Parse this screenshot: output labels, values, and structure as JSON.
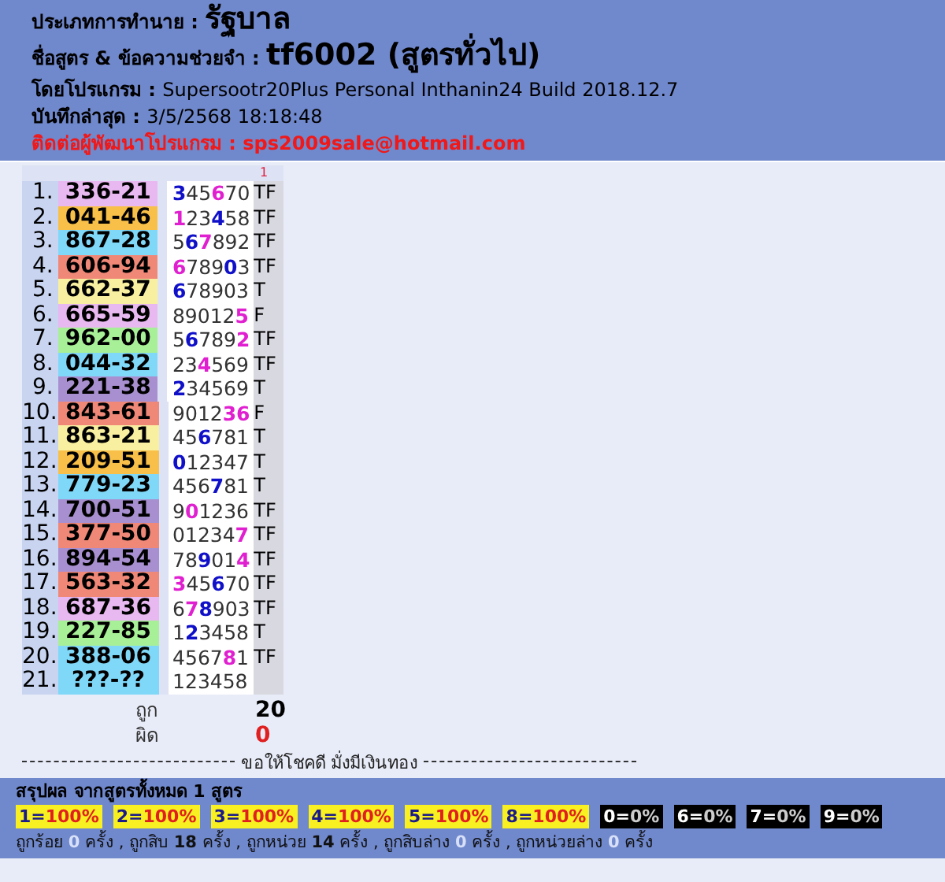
{
  "header": [
    {
      "kind": "title",
      "label": "ประเภทการทำนาย : ",
      "value": "รัฐบาล"
    },
    {
      "kind": "title",
      "label": "ชื่อสูตร & ข้อความช่วยจำ : ",
      "value": "tf6002 (สูตรทั่วไป)"
    },
    {
      "kind": "plain",
      "label": "โดยโปรแกรม : ",
      "value": "Supersootr20Plus Personal Inthanin24 Build 2018.12.7"
    },
    {
      "kind": "plain",
      "label": "บันทึกล่าสุด : ",
      "value": "3/5/2568 18:18:48"
    },
    {
      "kind": "alert",
      "label": "ติดต่อผู้พัฒนาโปรแกรม : ",
      "value": "sps2009sale@hotmail.com"
    }
  ],
  "column_marker": "1",
  "rows": [
    {
      "index": "1.",
      "number": "336-21",
      "color": "#e8b8f0",
      "digits": [
        {
          "d": "3",
          "color": "#1010c8"
        },
        {
          "d": "4"
        },
        {
          "d": "5"
        },
        {
          "d": "6",
          "color": "#e020d0"
        },
        {
          "d": "7"
        },
        {
          "d": "0"
        }
      ],
      "result": "TF"
    },
    {
      "index": "2.",
      "number": "041-46",
      "color": "#f8c048",
      "digits": [
        {
          "d": "1",
          "color": "#e020d0"
        },
        {
          "d": "2"
        },
        {
          "d": "3"
        },
        {
          "d": "4",
          "color": "#1010c8"
        },
        {
          "d": "5"
        },
        {
          "d": "8"
        }
      ],
      "result": "TF"
    },
    {
      "index": "3.",
      "number": "867-28",
      "color": "#80d8f8",
      "digits": [
        {
          "d": "5"
        },
        {
          "d": "6",
          "color": "#1010c8"
        },
        {
          "d": "7",
          "color": "#e020d0"
        },
        {
          "d": "8"
        },
        {
          "d": "9"
        },
        {
          "d": "2"
        }
      ],
      "result": "TF"
    },
    {
      "index": "4.",
      "number": "606-94",
      "color": "#f08878",
      "digits": [
        {
          "d": "6",
          "color": "#e020d0"
        },
        {
          "d": "7"
        },
        {
          "d": "8"
        },
        {
          "d": "9"
        },
        {
          "d": "0",
          "color": "#1010c8"
        },
        {
          "d": "3"
        }
      ],
      "result": "TF"
    },
    {
      "index": "5.",
      "number": "662-37",
      "color": "#f8f0a0",
      "digits": [
        {
          "d": "6",
          "color": "#1010c8"
        },
        {
          "d": "7"
        },
        {
          "d": "8"
        },
        {
          "d": "9"
        },
        {
          "d": "0"
        },
        {
          "d": "3"
        }
      ],
      "result": "T"
    },
    {
      "index": "6.",
      "number": "665-59",
      "color": "#e8b8f0",
      "digits": [
        {
          "d": "8"
        },
        {
          "d": "9"
        },
        {
          "d": "0"
        },
        {
          "d": "1"
        },
        {
          "d": "2"
        },
        {
          "d": "5",
          "color": "#e020d0"
        }
      ],
      "result": "F"
    },
    {
      "index": "7.",
      "number": "962-00",
      "color": "#a8f098",
      "digits": [
        {
          "d": "5"
        },
        {
          "d": "6",
          "color": "#1010c8"
        },
        {
          "d": "7"
        },
        {
          "d": "8"
        },
        {
          "d": "9"
        },
        {
          "d": "2",
          "color": "#e020d0"
        }
      ],
      "result": "TF"
    },
    {
      "index": "8.",
      "number": "044-32",
      "color": "#80d8f8",
      "digits": [
        {
          "d": "2"
        },
        {
          "d": "3"
        },
        {
          "d": "4",
          "color": "#e020d0"
        },
        {
          "d": "5"
        },
        {
          "d": "6"
        },
        {
          "d": "9"
        }
      ],
      "result": "TF"
    },
    {
      "index": "9.",
      "number": "221-38",
      "color": "#a890d0",
      "digits": [
        {
          "d": "2",
          "color": "#1010c8"
        },
        {
          "d": "3"
        },
        {
          "d": "4"
        },
        {
          "d": "5"
        },
        {
          "d": "6"
        },
        {
          "d": "9"
        }
      ],
      "result": "T"
    },
    {
      "index": "10.",
      "number": "843-61",
      "color": "#f08878",
      "digits": [
        {
          "d": "9"
        },
        {
          "d": "0"
        },
        {
          "d": "1"
        },
        {
          "d": "2"
        },
        {
          "d": "3",
          "color": "#e020d0"
        },
        {
          "d": "6",
          "color": "#e020d0"
        }
      ],
      "result": "F"
    },
    {
      "index": "11.",
      "number": "863-21",
      "color": "#f8f0a0",
      "digits": [
        {
          "d": "4"
        },
        {
          "d": "5"
        },
        {
          "d": "6",
          "color": "#1010c8"
        },
        {
          "d": "7"
        },
        {
          "d": "8"
        },
        {
          "d": "1"
        }
      ],
      "result": "T"
    },
    {
      "index": "12.",
      "number": "209-51",
      "color": "#f8c048",
      "digits": [
        {
          "d": "0",
          "color": "#1010c8"
        },
        {
          "d": "1"
        },
        {
          "d": "2"
        },
        {
          "d": "3"
        },
        {
          "d": "4"
        },
        {
          "d": "7"
        }
      ],
      "result": "T"
    },
    {
      "index": "13.",
      "number": "779-23",
      "color": "#80d8f8",
      "digits": [
        {
          "d": "4"
        },
        {
          "d": "5"
        },
        {
          "d": "6"
        },
        {
          "d": "7",
          "color": "#1010c8"
        },
        {
          "d": "8"
        },
        {
          "d": "1"
        }
      ],
      "result": "T"
    },
    {
      "index": "14.",
      "number": "700-51",
      "color": "#a890d0",
      "digits": [
        {
          "d": "9"
        },
        {
          "d": "0",
          "color": "#e020d0"
        },
        {
          "d": "1"
        },
        {
          "d": "2"
        },
        {
          "d": "3"
        },
        {
          "d": "6"
        }
      ],
      "result": "TF"
    },
    {
      "index": "15.",
      "number": "377-50",
      "color": "#f08878",
      "digits": [
        {
          "d": "0"
        },
        {
          "d": "1"
        },
        {
          "d": "2"
        },
        {
          "d": "3"
        },
        {
          "d": "4"
        },
        {
          "d": "7",
          "color": "#e020d0"
        }
      ],
      "result": "TF"
    },
    {
      "index": "16.",
      "number": "894-54",
      "color": "#a890d0",
      "digits": [
        {
          "d": "7"
        },
        {
          "d": "8"
        },
        {
          "d": "9",
          "color": "#1010c8"
        },
        {
          "d": "0"
        },
        {
          "d": "1"
        },
        {
          "d": "4",
          "color": "#e020d0"
        }
      ],
      "result": "TF"
    },
    {
      "index": "17.",
      "number": "563-32",
      "color": "#f08878",
      "digits": [
        {
          "d": "3",
          "color": "#e020d0"
        },
        {
          "d": "4"
        },
        {
          "d": "5"
        },
        {
          "d": "6",
          "color": "#1010c8"
        },
        {
          "d": "7"
        },
        {
          "d": "0"
        }
      ],
      "result": "TF"
    },
    {
      "index": "18.",
      "number": "687-36",
      "color": "#e8b8f0",
      "digits": [
        {
          "d": "6"
        },
        {
          "d": "7",
          "color": "#e020d0"
        },
        {
          "d": "8",
          "color": "#1010c8"
        },
        {
          "d": "9"
        },
        {
          "d": "0"
        },
        {
          "d": "3"
        }
      ],
      "result": "TF"
    },
    {
      "index": "19.",
      "number": "227-85",
      "color": "#a8f098",
      "digits": [
        {
          "d": "1"
        },
        {
          "d": "2",
          "color": "#1010c8"
        },
        {
          "d": "3"
        },
        {
          "d": "4"
        },
        {
          "d": "5"
        },
        {
          "d": "8"
        }
      ],
      "result": "T"
    },
    {
      "index": "20.",
      "number": "388-06",
      "color": "#80d8f8",
      "digits": [
        {
          "d": "4"
        },
        {
          "d": "5"
        },
        {
          "d": "6"
        },
        {
          "d": "7"
        },
        {
          "d": "8",
          "color": "#e020d0"
        },
        {
          "d": "1"
        }
      ],
      "result": "TF"
    },
    {
      "index": "21.",
      "number": "???-??",
      "color": "#80d8f8",
      "digits": [
        {
          "d": "1"
        },
        {
          "d": "2"
        },
        {
          "d": "3"
        },
        {
          "d": "4"
        },
        {
          "d": "5"
        },
        {
          "d": "8"
        }
      ]
    }
  ],
  "totals": [
    {
      "kind": "correct",
      "label": "ถูก",
      "value": "20"
    },
    {
      "kind": "wrong",
      "label": "ผิด",
      "value": "0"
    }
  ],
  "divider_text": "ขอให้โชคดี มั่งมีเงินทอง",
  "summary": {
    "title": "สรุปผล จากสูตรทั้งหมด 1 สูตร",
    "badges": [
      {
        "key": "1=",
        "value": "100%",
        "hit": true
      },
      {
        "key": "2=",
        "value": "100%",
        "hit": true
      },
      {
        "key": "3=",
        "value": "100%",
        "hit": true
      },
      {
        "key": "4=",
        "value": "100%",
        "hit": true
      },
      {
        "key": "5=",
        "value": "100%",
        "hit": true
      },
      {
        "key": "8=",
        "value": "100%",
        "hit": true
      },
      {
        "key": "0=",
        "value": "0%",
        "hit": false
      },
      {
        "key": "6=",
        "value": "0%",
        "hit": false
      },
      {
        "key": "7=",
        "value": "0%",
        "hit": false
      },
      {
        "key": "9=",
        "value": "0%",
        "hit": false
      }
    ],
    "stats": [
      {
        "label": "ถูกร้อย",
        "count": "0",
        "unit": "ครั้ง",
        "faded": true
      },
      {
        "label": "ถูกสิบ",
        "count": "18",
        "unit": "ครั้ง",
        "faded": false
      },
      {
        "label": "ถูกหน่วย",
        "count": "14",
        "unit": "ครั้ง",
        "faded": false
      },
      {
        "label": "ถูกสิบล่าง",
        "count": "0",
        "unit": "ครั้ง",
        "faded": true
      },
      {
        "label": "ถูกหน่วยล่าง",
        "count": "0",
        "unit": "ครั้ง",
        "faded": true
      }
    ],
    "separator": ","
  }
}
